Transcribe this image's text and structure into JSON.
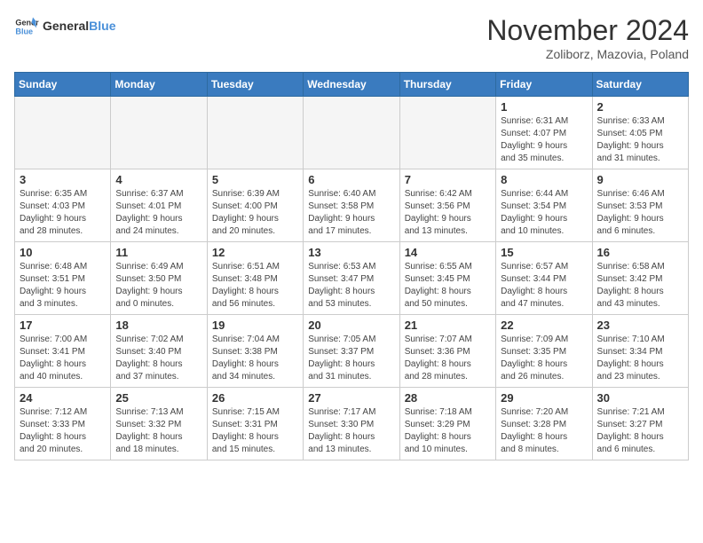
{
  "header": {
    "logo_general": "General",
    "logo_blue": "Blue",
    "title": "November 2024",
    "subtitle": "Zoliborz, Mazovia, Poland"
  },
  "weekdays": [
    "Sunday",
    "Monday",
    "Tuesday",
    "Wednesday",
    "Thursday",
    "Friday",
    "Saturday"
  ],
  "weeks": [
    [
      {
        "day": "",
        "info": "",
        "empty": true
      },
      {
        "day": "",
        "info": "",
        "empty": true
      },
      {
        "day": "",
        "info": "",
        "empty": true
      },
      {
        "day": "",
        "info": "",
        "empty": true
      },
      {
        "day": "",
        "info": "",
        "empty": true
      },
      {
        "day": "1",
        "info": "Sunrise: 6:31 AM\nSunset: 4:07 PM\nDaylight: 9 hours\nand 35 minutes."
      },
      {
        "day": "2",
        "info": "Sunrise: 6:33 AM\nSunset: 4:05 PM\nDaylight: 9 hours\nand 31 minutes."
      }
    ],
    [
      {
        "day": "3",
        "info": "Sunrise: 6:35 AM\nSunset: 4:03 PM\nDaylight: 9 hours\nand 28 minutes."
      },
      {
        "day": "4",
        "info": "Sunrise: 6:37 AM\nSunset: 4:01 PM\nDaylight: 9 hours\nand 24 minutes."
      },
      {
        "day": "5",
        "info": "Sunrise: 6:39 AM\nSunset: 4:00 PM\nDaylight: 9 hours\nand 20 minutes."
      },
      {
        "day": "6",
        "info": "Sunrise: 6:40 AM\nSunset: 3:58 PM\nDaylight: 9 hours\nand 17 minutes."
      },
      {
        "day": "7",
        "info": "Sunrise: 6:42 AM\nSunset: 3:56 PM\nDaylight: 9 hours\nand 13 minutes."
      },
      {
        "day": "8",
        "info": "Sunrise: 6:44 AM\nSunset: 3:54 PM\nDaylight: 9 hours\nand 10 minutes."
      },
      {
        "day": "9",
        "info": "Sunrise: 6:46 AM\nSunset: 3:53 PM\nDaylight: 9 hours\nand 6 minutes."
      }
    ],
    [
      {
        "day": "10",
        "info": "Sunrise: 6:48 AM\nSunset: 3:51 PM\nDaylight: 9 hours\nand 3 minutes."
      },
      {
        "day": "11",
        "info": "Sunrise: 6:49 AM\nSunset: 3:50 PM\nDaylight: 9 hours\nand 0 minutes."
      },
      {
        "day": "12",
        "info": "Sunrise: 6:51 AM\nSunset: 3:48 PM\nDaylight: 8 hours\nand 56 minutes."
      },
      {
        "day": "13",
        "info": "Sunrise: 6:53 AM\nSunset: 3:47 PM\nDaylight: 8 hours\nand 53 minutes."
      },
      {
        "day": "14",
        "info": "Sunrise: 6:55 AM\nSunset: 3:45 PM\nDaylight: 8 hours\nand 50 minutes."
      },
      {
        "day": "15",
        "info": "Sunrise: 6:57 AM\nSunset: 3:44 PM\nDaylight: 8 hours\nand 47 minutes."
      },
      {
        "day": "16",
        "info": "Sunrise: 6:58 AM\nSunset: 3:42 PM\nDaylight: 8 hours\nand 43 minutes."
      }
    ],
    [
      {
        "day": "17",
        "info": "Sunrise: 7:00 AM\nSunset: 3:41 PM\nDaylight: 8 hours\nand 40 minutes."
      },
      {
        "day": "18",
        "info": "Sunrise: 7:02 AM\nSunset: 3:40 PM\nDaylight: 8 hours\nand 37 minutes."
      },
      {
        "day": "19",
        "info": "Sunrise: 7:04 AM\nSunset: 3:38 PM\nDaylight: 8 hours\nand 34 minutes."
      },
      {
        "day": "20",
        "info": "Sunrise: 7:05 AM\nSunset: 3:37 PM\nDaylight: 8 hours\nand 31 minutes."
      },
      {
        "day": "21",
        "info": "Sunrise: 7:07 AM\nSunset: 3:36 PM\nDaylight: 8 hours\nand 28 minutes."
      },
      {
        "day": "22",
        "info": "Sunrise: 7:09 AM\nSunset: 3:35 PM\nDaylight: 8 hours\nand 26 minutes."
      },
      {
        "day": "23",
        "info": "Sunrise: 7:10 AM\nSunset: 3:34 PM\nDaylight: 8 hours\nand 23 minutes."
      }
    ],
    [
      {
        "day": "24",
        "info": "Sunrise: 7:12 AM\nSunset: 3:33 PM\nDaylight: 8 hours\nand 20 minutes."
      },
      {
        "day": "25",
        "info": "Sunrise: 7:13 AM\nSunset: 3:32 PM\nDaylight: 8 hours\nand 18 minutes."
      },
      {
        "day": "26",
        "info": "Sunrise: 7:15 AM\nSunset: 3:31 PM\nDaylight: 8 hours\nand 15 minutes."
      },
      {
        "day": "27",
        "info": "Sunrise: 7:17 AM\nSunset: 3:30 PM\nDaylight: 8 hours\nand 13 minutes."
      },
      {
        "day": "28",
        "info": "Sunrise: 7:18 AM\nSunset: 3:29 PM\nDaylight: 8 hours\nand 10 minutes."
      },
      {
        "day": "29",
        "info": "Sunrise: 7:20 AM\nSunset: 3:28 PM\nDaylight: 8 hours\nand 8 minutes."
      },
      {
        "day": "30",
        "info": "Sunrise: 7:21 AM\nSunset: 3:27 PM\nDaylight: 8 hours\nand 6 minutes."
      }
    ]
  ]
}
